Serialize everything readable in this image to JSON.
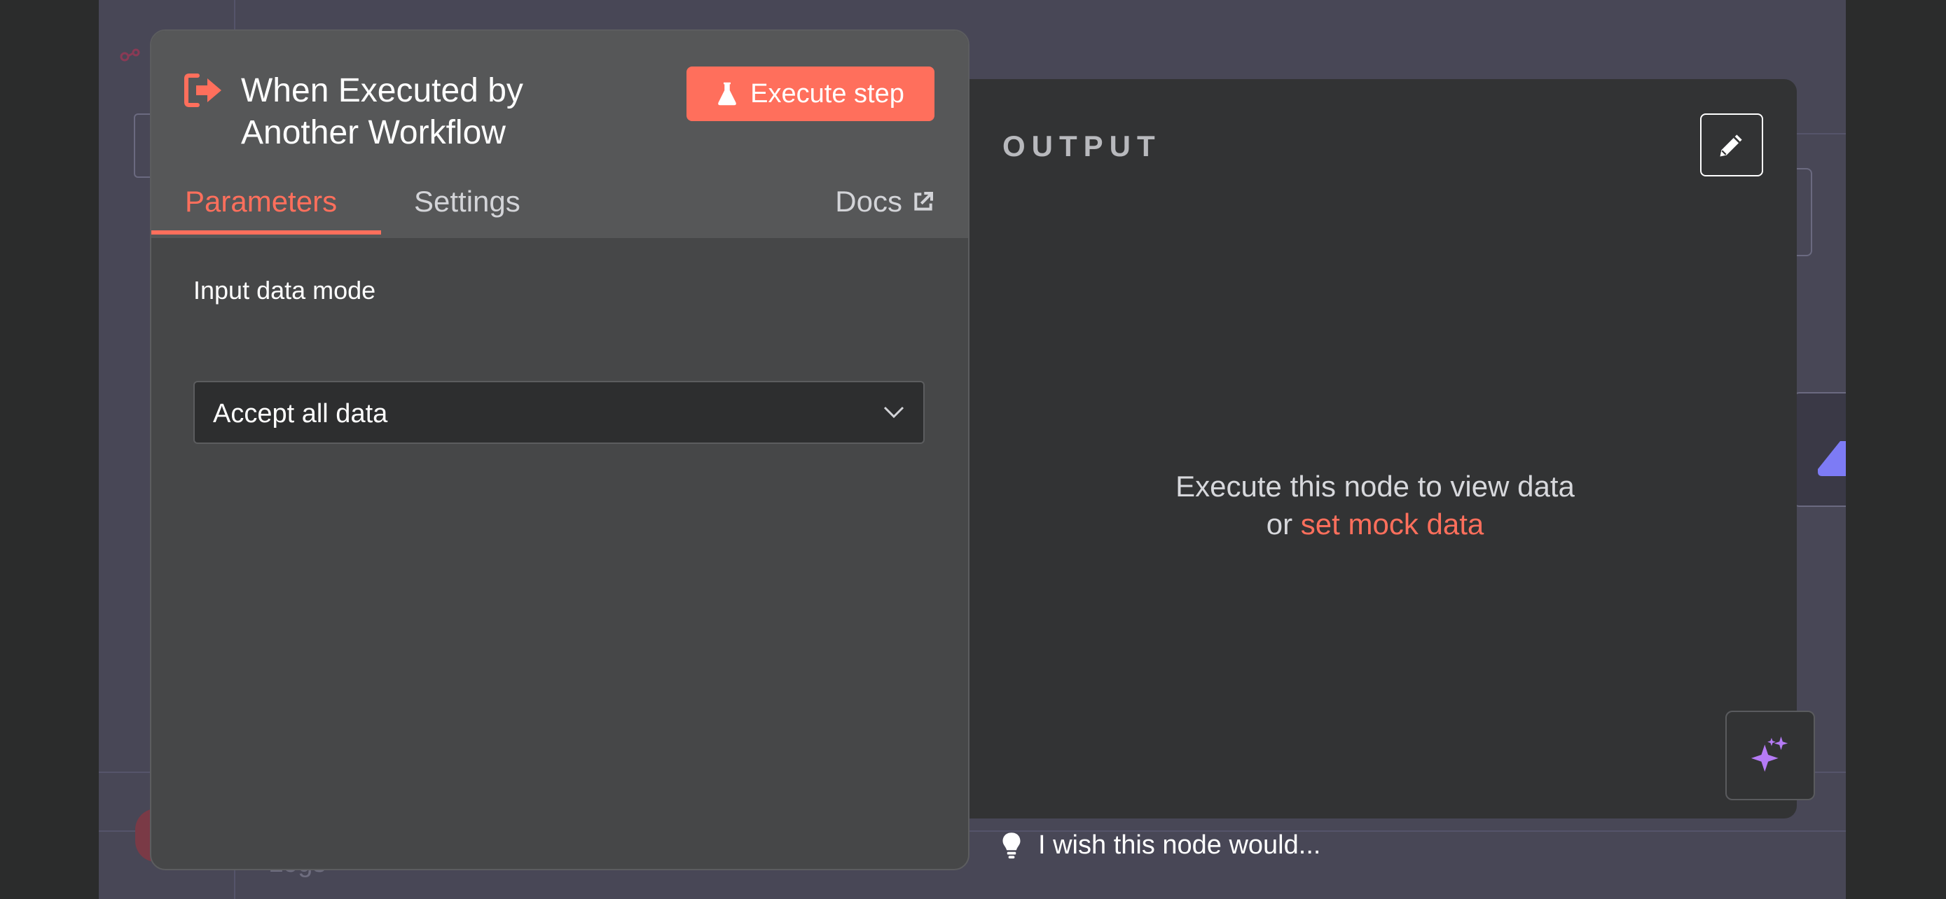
{
  "backdrop": {
    "logs_label": "Logs"
  },
  "node_panel": {
    "title": "When Executed by Another Workflow",
    "execute_label": "Execute step",
    "tabs": [
      {
        "label": "Parameters",
        "active": true
      },
      {
        "label": "Settings",
        "active": false
      }
    ],
    "docs_label": "Docs",
    "field": {
      "label": "Input data mode",
      "value": "Accept all data"
    }
  },
  "output": {
    "title": "OUTPUT",
    "empty_line1": "Execute this node to view data",
    "empty_prefix": "or",
    "empty_link": "set mock data"
  },
  "feedback": {
    "text": "I wish this node would..."
  },
  "colors": {
    "accent": "#ff6f5c",
    "ai_purple": "#b57bf5",
    "node_blue": "#7d7bf5"
  },
  "icons": [
    "trigger-icon",
    "flask-icon",
    "external-link-icon",
    "pencil-icon",
    "chevron-down-icon",
    "sparkles-icon",
    "lightbulb-icon",
    "chevron-up-icon"
  ]
}
